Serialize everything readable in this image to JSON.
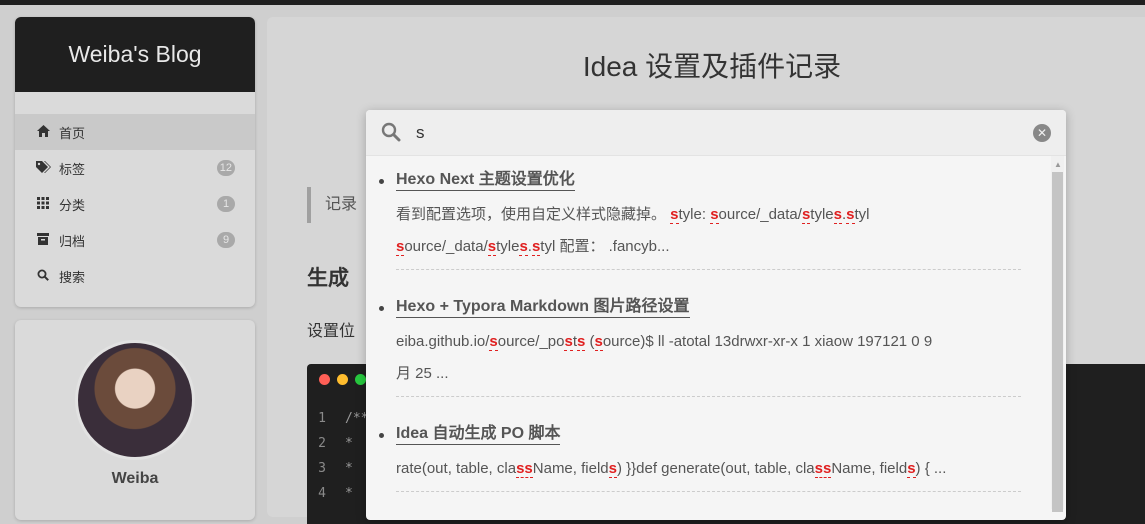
{
  "blog": {
    "title": "Weiba's Blog",
    "menu": [
      {
        "label": "首页",
        "icon": "home-icon",
        "badge": null
      },
      {
        "label": "标签",
        "icon": "tags-icon",
        "badge": "12"
      },
      {
        "label": "分类",
        "icon": "grid-icon",
        "badge": "1"
      },
      {
        "label": "归档",
        "icon": "archive-icon",
        "badge": "9"
      },
      {
        "label": "搜索",
        "icon": "search-icon",
        "badge": null
      }
    ],
    "author": "Weiba"
  },
  "post": {
    "title": "Idea 设置及插件记录",
    "quote": "记录",
    "heading": "生成",
    "para": "设置位",
    "code_lines": [
      {
        "num": "1",
        "text": "/**"
      },
      {
        "num": "2",
        "text": "*"
      },
      {
        "num": "3",
        "text": "*"
      },
      {
        "num": "4",
        "text": "*"
      }
    ]
  },
  "search": {
    "query": "s",
    "results": [
      {
        "title": "Hexo Next 主题设置优化",
        "snippet_lines": [
          [
            {
              "t": "看到配置选项，使用自定义样式隐藏掉。 "
            },
            {
              "t": "s",
              "h": true
            },
            {
              "t": "tyle: "
            },
            {
              "t": "s",
              "h": true
            },
            {
              "t": "ource/_data/"
            },
            {
              "t": "s",
              "h": true
            },
            {
              "t": "tyle"
            },
            {
              "t": "s",
              "h": true
            },
            {
              "t": "."
            },
            {
              "t": "s",
              "h": true
            },
            {
              "t": "tyl"
            }
          ],
          [
            {
              "t": "s",
              "h": true
            },
            {
              "t": "ource/_data/"
            },
            {
              "t": "s",
              "h": true
            },
            {
              "t": "tyle"
            },
            {
              "t": "s",
              "h": true
            },
            {
              "t": "."
            },
            {
              "t": "s",
              "h": true
            },
            {
              "t": "tyl 配置： .fancyb..."
            }
          ]
        ]
      },
      {
        "title": "Hexo + Typora Markdown 图片路径设置",
        "snippet_lines": [
          [
            {
              "t": "eiba.github.io/"
            },
            {
              "t": "s",
              "h": true
            },
            {
              "t": "ource/_po"
            },
            {
              "t": "s",
              "h": true
            },
            {
              "t": "t"
            },
            {
              "t": "s",
              "h": true
            },
            {
              "t": " ("
            },
            {
              "t": "s",
              "h": true
            },
            {
              "t": "ource)$ ll -atotal 13drwxr-xr-x 1 xiaow 197121 0 9"
            }
          ],
          [
            {
              "t": "月 25 ..."
            }
          ]
        ]
      },
      {
        "title": "Idea 自动生成 PO 脚本",
        "snippet_lines": [
          [
            {
              "t": "rate(out, table, cla"
            },
            {
              "t": "ss",
              "h": true
            },
            {
              "t": "Name, field"
            },
            {
              "t": "s",
              "h": true
            },
            {
              "t": ") }}def generate(out, table, cla"
            },
            {
              "t": "ss",
              "h": true
            },
            {
              "t": "Name, field"
            },
            {
              "t": "s",
              "h": true
            },
            {
              "t": ") { ..."
            }
          ]
        ]
      }
    ]
  },
  "colors": {
    "highlight": "#e02020",
    "brand_bg": "#1f1f1f",
    "mac_red": "#ff5f56",
    "mac_yellow": "#ffbd2e",
    "mac_green": "#27c93f"
  }
}
